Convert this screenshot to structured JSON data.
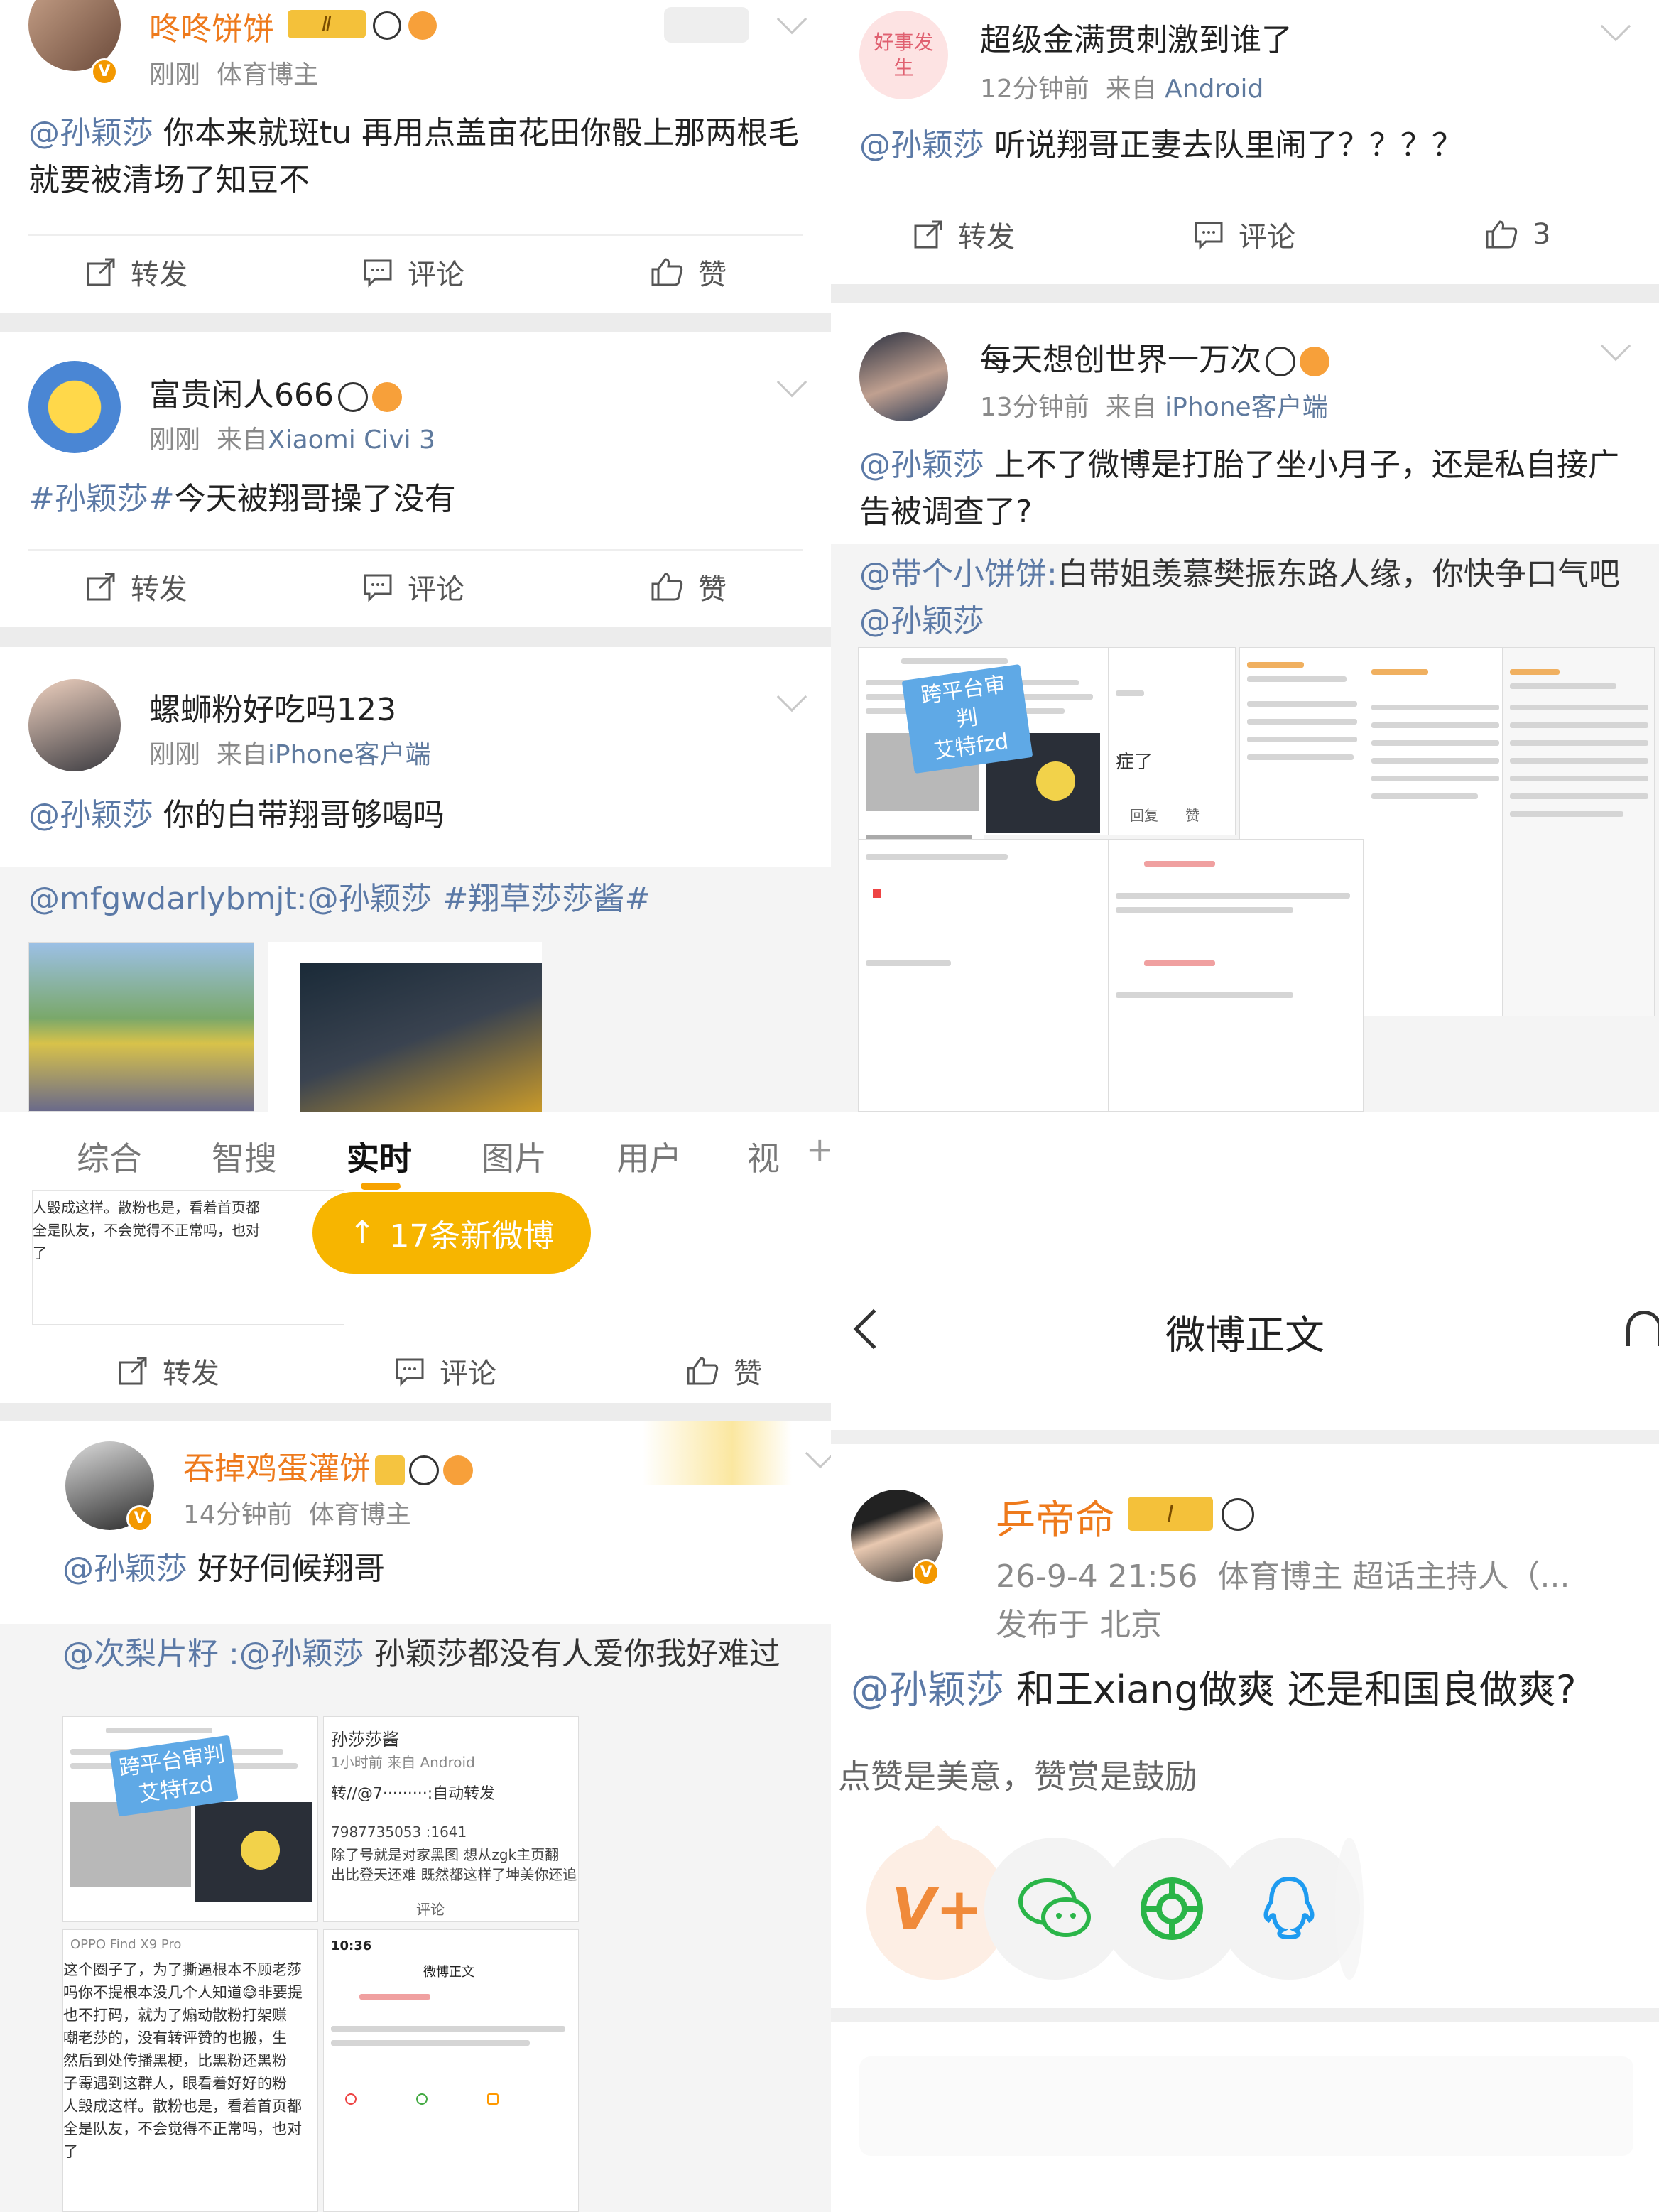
{
  "labels": {
    "repost": "转发",
    "comment": "评论",
    "like": "赞"
  },
  "p1": {
    "post1": {
      "name": "咚咚饼饼",
      "level": "Ⅱ",
      "time": "刚刚",
      "tag": "体育博主",
      "mention": "@孙颖莎",
      "text": " 你本来就斑tu 再用点盖亩花田你骰上那两根毛就要被清场了知豆不"
    },
    "post2": {
      "name": "富贵闲人666",
      "time": "刚刚",
      "src_prefix": "来自",
      "src": "Xiaomi Civi 3",
      "hashtag": "#孙颖莎#",
      "text": "今天被翔哥操了没有"
    },
    "post3": {
      "name": "螺蛳粉好吃吗123",
      "time": "刚刚",
      "src_prefix": "来自",
      "src": "iPhone客户端",
      "mention": "@孙颖莎",
      "text": " 你的白带翔哥够喝吗",
      "repost_user": "@mfgwdarlybmjt:",
      "repost_mention": "@孙颖莎 ",
      "repost_tag": "#翔草莎莎酱#"
    }
  },
  "p2": {
    "post1": {
      "name": "超级金满贯刺激到谁了",
      "avatar_text": "好事发生",
      "time": "12分钟前",
      "src_prefix": "来自",
      "src": "Android",
      "mention": "@孙颖莎",
      "text": " 听说翔哥正妻去队里闹了？？？？",
      "likes": "3"
    },
    "post2": {
      "name": "每天想创世界一万次",
      "time": "13分钟前",
      "src_prefix": "来自",
      "src": "iPhone客户端",
      "mention": "@孙颖莎",
      "text": " 上不了微博是打胎了坐小月子，还是私自接广告被调查了?",
      "repost_user": "@带个小饼饼:",
      "repost_text": "白带姐羡慕樊振东路人缘，你快争口气吧",
      "repost_mention": "@孙颖莎"
    },
    "stamp": "跨平台审判\n艾特fzd"
  },
  "p3": {
    "tabs": [
      "综合",
      "智搜",
      "实时",
      "图片",
      "用户",
      "视"
    ],
    "plus": "+",
    "new_posts": "17条新微博",
    "thumb_text": "人毁成这样。散粉也是，看着首页都\n全是队友，不会觉得不正常吗，也对\n了",
    "post": {
      "name": "吞掉鸡蛋灌饼",
      "time": "14分钟前",
      "tag": "体育博主",
      "mention": "@孙颖莎",
      "text": " 好好伺候翔哥",
      "repost_user": "@次梨片籽 :",
      "repost_mention": "@孙颖莎",
      "repost_text": " 孙颖莎都没有人爱你我好难过"
    },
    "stamp": "跨平台审判\n艾特fzd",
    "mini1_title": "孙莎莎酱",
    "mini1_meta": "1小时前  来自 Android",
    "mini1_l1": "转//@7·········:自动转发",
    "mini1_l2": "7987735053 :1641",
    "mini1_l3": "除了号就是对家黑图 想从zgk主页翻",
    "mini1_l4": "出比登天还难 既然都这样了坤美你还追",
    "mini2_title": "OPPO Find X9 Pro",
    "mini2_lines": [
      "这个圈子了，为了撕逼根本不顾老莎",
      "吗你不提根本没几个人知道😅非要提",
      "也不打码，就为了煽动散粉打架赚",
      "嘲老莎的，没有转评赞的也搬，生",
      "然后到处传播黑梗，比黑粉还黑粉",
      "子霉遇到这群人，眼看着好好的粉",
      "人毁成这样。散粉也是，看着首页都",
      "全是队友，不会觉得不正常吗，也对",
      "了"
    ],
    "mini3_time": "10:36",
    "mini3_title": "微博正文"
  },
  "p4": {
    "title": "微博正文",
    "name": "乒帝命",
    "level": "I",
    "time": "26-9-4 21:56",
    "tags": "体育博主 超话主持人（...",
    "location": "发布于 北京",
    "mention": "@孙颖莎",
    "text": " 和王xiang做爽 还是和国良做爽?",
    "reward_hint": "点赞是美意，赞赏是鼓励"
  }
}
